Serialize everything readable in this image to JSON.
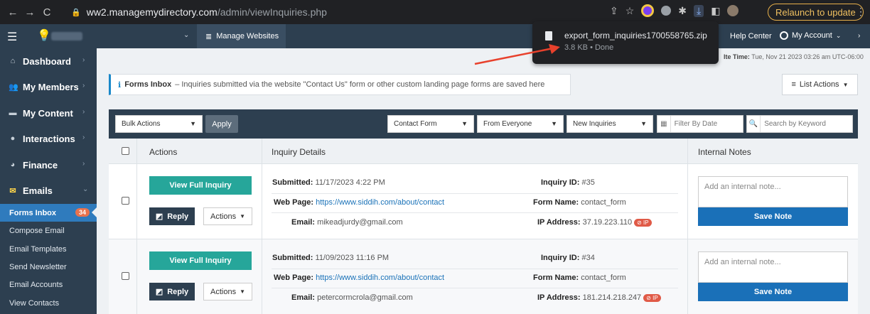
{
  "browser": {
    "url_host": "ww2.managemydirectory.com",
    "url_path": "/admin/viewInquiries.php",
    "relaunch_label": "Relaunch to update"
  },
  "download": {
    "file_name": "export_form_inquiries1700558765.zip",
    "status": "3.8 KB • Done"
  },
  "header": {
    "manage_websites": "Manage Websites",
    "help_center": "Help Center",
    "my_account": "My Account"
  },
  "sidebar": {
    "items": [
      {
        "label": "Dashboard",
        "icon": "home-icon"
      },
      {
        "label": "My Members",
        "icon": "users-icon"
      },
      {
        "label": "My Content",
        "icon": "folder-icon"
      },
      {
        "label": "Interactions",
        "icon": "chat-icon"
      },
      {
        "label": "Finance",
        "icon": "finance-icon"
      },
      {
        "label": "Emails",
        "icon": "envelope-icon"
      }
    ],
    "sub_items": [
      {
        "label": "Forms Inbox",
        "badge": "34"
      },
      {
        "label": "Compose Email"
      },
      {
        "label": "Email Templates"
      },
      {
        "label": "Send Newsletter"
      },
      {
        "label": "Email Accounts"
      },
      {
        "label": "View Contacts"
      }
    ]
  },
  "site_time": {
    "label": "lte Time:",
    "value": "Tue, Nov 21 2023 03:26 am UTC-06:00"
  },
  "banner": {
    "title": "Forms Inbox",
    "text": " – Inquiries submitted via the website \"Contact Us\" form or other custom landing page forms are saved here"
  },
  "list_actions_label": "List Actions",
  "filters": {
    "bulk_actions": "Bulk Actions",
    "apply": "Apply",
    "form": "Contact Form",
    "from": "From Everyone",
    "status": "New Inquiries",
    "date_placeholder": "Filter By Date",
    "search_placeholder": "Search by Keyword"
  },
  "table": {
    "headers": {
      "actions": "Actions",
      "details": "Inquiry Details",
      "notes": "Internal Notes"
    },
    "labels": {
      "submitted": "Submitted:",
      "web_page": "Web Page:",
      "email": "Email:",
      "inquiry_id": "Inquiry ID:",
      "form_name": "Form Name:",
      "ip_address": "IP Address:",
      "view_full": "View Full Inquiry",
      "reply": "Reply",
      "actions": "Actions",
      "note_placeholder": "Add an internal note...",
      "save_note": "Save Note",
      "ip_badge": "⊘ IP"
    },
    "rows": [
      {
        "submitted": "11/17/2023 4:22 PM",
        "web_page": "https://www.siddih.com/about/contact",
        "email": "mikeadjurdy@gmail.com",
        "inquiry_id": "#35",
        "form_name": "contact_form",
        "ip_address": "37.19.223.110"
      },
      {
        "submitted": "11/09/2023 11:16 PM",
        "web_page": "https://www.siddih.com/about/contact",
        "email": "petercormcrola@gmail.com",
        "inquiry_id": "#34",
        "form_name": "contact_form",
        "ip_address": "181.214.218.247"
      }
    ]
  },
  "colors": {
    "nav_dark": "#2d3f50",
    "teal": "#26a69a",
    "blue": "#1a70b8",
    "badge_red": "#e05a47"
  }
}
